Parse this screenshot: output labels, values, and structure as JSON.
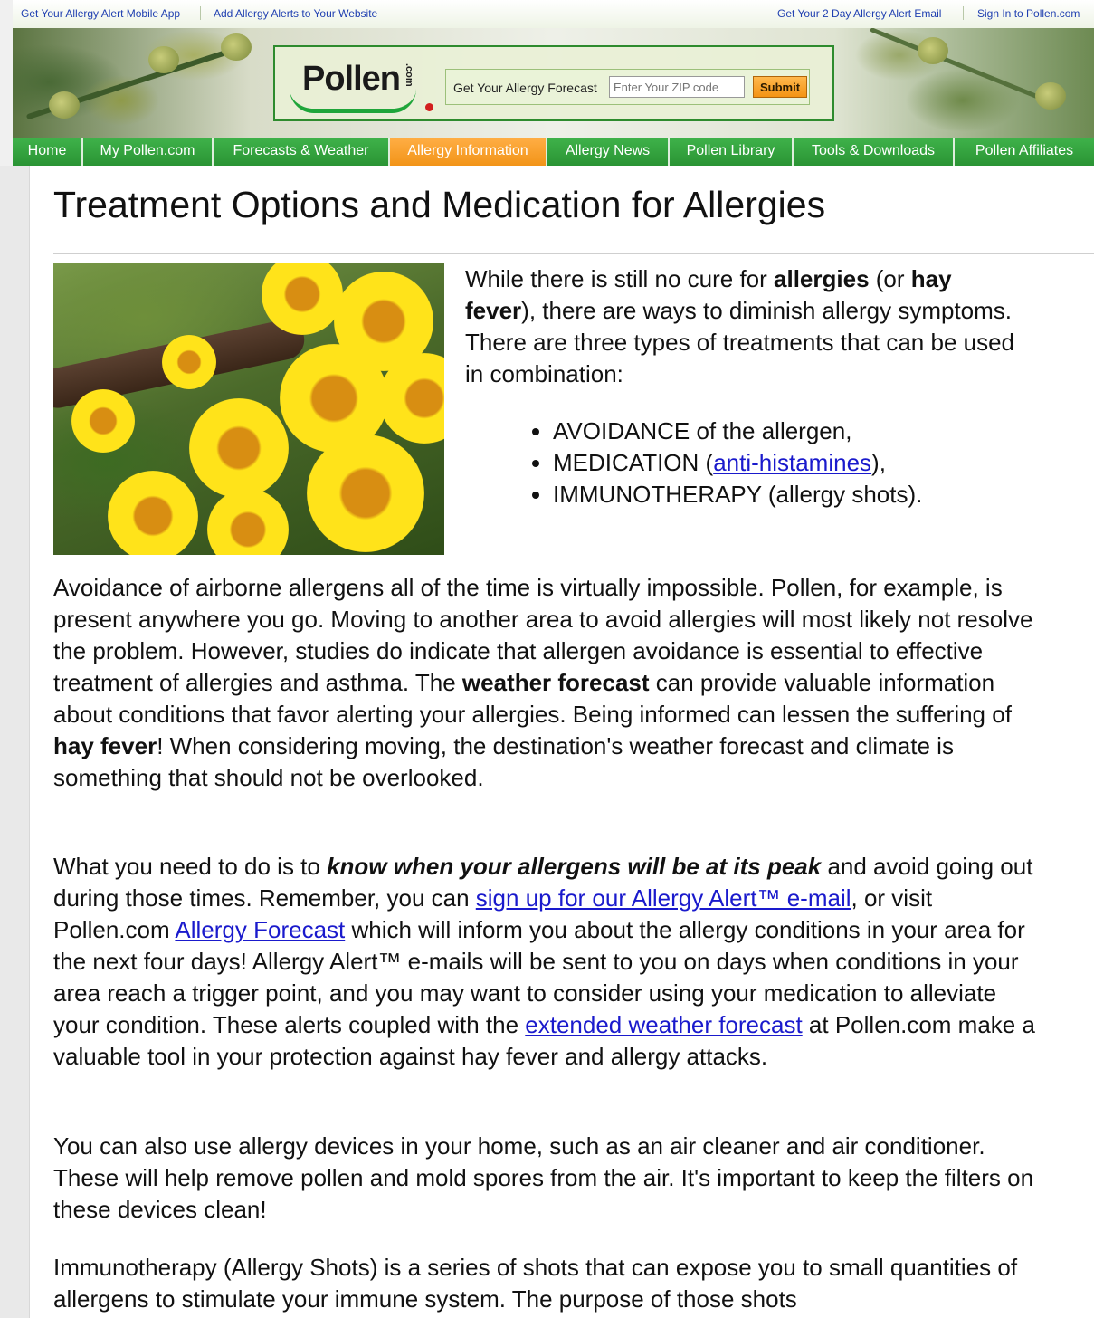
{
  "top_links": {
    "mobile_app": "Get Your Allergy Alert Mobile App",
    "add_alerts": "Add Allergy Alerts to Your Website",
    "email": "Get Your 2 Day Allergy Alert Email",
    "sign_in": "Sign In to Pollen.com"
  },
  "header": {
    "logo_text": "Pollen",
    "logo_suffix": ".com",
    "forecast_label": "Get Your Allergy Forecast",
    "zip_placeholder": "Enter Your ZIP code",
    "submit_label": "Submit"
  },
  "nav": {
    "items": [
      {
        "label": "Home"
      },
      {
        "label": "My Pollen.com"
      },
      {
        "label": "Forecasts & Weather"
      },
      {
        "label": "Allergy Information",
        "active": true
      },
      {
        "label": "Allergy News"
      },
      {
        "label": "Pollen Library"
      },
      {
        "label": "Tools & Downloads"
      },
      {
        "label": "Pollen Affiliates"
      }
    ]
  },
  "article": {
    "title": "Treatment Options and Medication for Allergies",
    "intro": {
      "t1": "While there is still no cure for ",
      "b1": "allergies",
      "t2": " (or ",
      "b2": "hay fever",
      "t3": "), there are ways to diminish allergy symptoms. There are three types of treatments that can be used in combination:"
    },
    "bullets": {
      "b1": "AVOIDANCE of the allergen,",
      "b2_pre": "MEDICATION (",
      "b2_link": "anti-histamines",
      "b2_post": "),",
      "b3": "IMMUNOTHERAPY (allergy shots)."
    },
    "p1": {
      "t1": "Avoidance of airborne allergens all of the time is virtually impossible. Pollen, for example, is present anywhere you go. Moving to another area to avoid allergies will most likely not resolve the problem. However, studies do indicate that allergen avoidance is essential to effective treatment of allergies and asthma. The ",
      "b1": "weather forecast",
      "t2": " can provide valuable information about conditions that favor alerting your allergies. Being informed can lessen the suffering of ",
      "b2": "hay fever",
      "t3": "! When considering moving, the destination's weather forecast and climate is something that should not be overlooked."
    },
    "p2": {
      "t1": "What you need to do is to ",
      "bi": "know when your allergens will be at its peak",
      "t2": " and avoid going out during those times. Remember, you can ",
      "l1": "sign up for our Allergy Alert™ e-mail",
      "t3": ", or visit Pollen.com ",
      "l2": "Allergy Forecast",
      "t4": " which will inform you about the allergy conditions in your area for the next four days! Allergy Alert™ e-mails will be sent to you on days when conditions in your area reach a trigger point, and you may want to consider using your medication to alleviate your condition. These alerts coupled with the ",
      "l3": "extended weather forecast",
      "t5": " at Pollen.com make a valuable tool in your protection against hay fever and allergy attacks."
    },
    "p3": "You can also use allergy devices in your home, such as an air cleaner and air conditioner. These will help remove pollen and mold spores from the air. It's important to keep the filters on these devices clean!",
    "p4": "Immunotherapy (Allergy Shots) is a series of shots that can expose you to small quantities of allergens to stimulate your immune system. The purpose of those shots"
  },
  "colors": {
    "nav_green": "#2e9e3a",
    "nav_active": "#f29418",
    "link_blue": "#1a1acc",
    "top_link_blue": "#1f3fb0"
  }
}
